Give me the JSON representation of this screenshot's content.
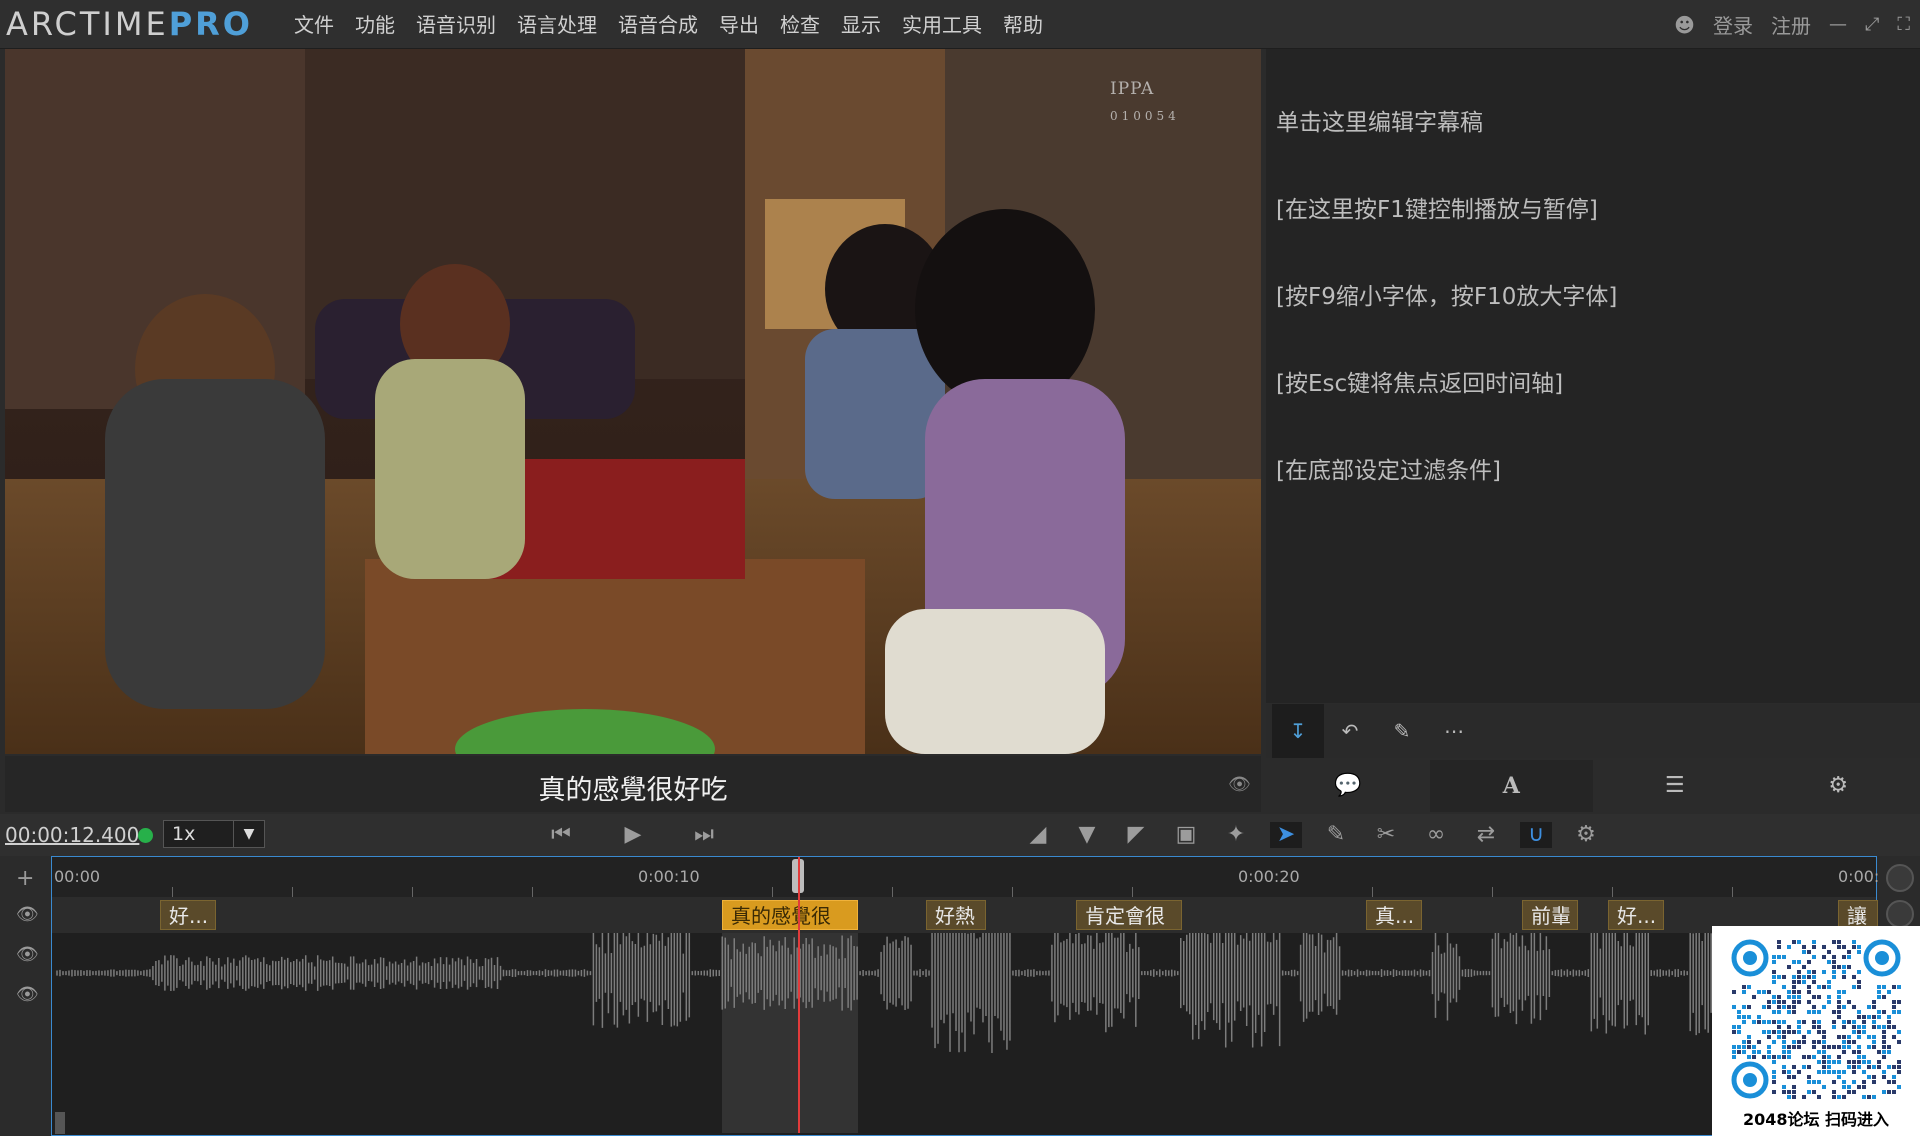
{
  "app": {
    "logo_main": "ARCTIME",
    "logo_pro": "PRO",
    "menus": [
      "文件",
      "功能",
      "语音识别",
      "语言处理",
      "语音合成",
      "导出",
      "检查",
      "显示",
      "实用工具",
      "帮助"
    ],
    "login": "登录",
    "register": "注册"
  },
  "video": {
    "watermark_brand": "IPPA",
    "watermark_code": "010054",
    "current_subtitle": "真的感覺很好吃"
  },
  "editor": {
    "lines": [
      "单击这里编辑字幕稿",
      "[在这里按F1键控制播放与暂停]",
      "[按F9缩小字体，按F10放大字体]",
      "[按Esc键将焦点返回时间轴]",
      "[在底部设定过滤条件]"
    ]
  },
  "transport": {
    "timecode": "00:00:12.400",
    "speed": "1x"
  },
  "timeline": {
    "ruler_labels": [
      "00:00",
      "0:00:10",
      "0:00:20",
      "0:00:"
    ],
    "segments": [
      {
        "text": "好..."
      },
      {
        "text": "真的感覺很",
        "active": true
      },
      {
        "text": "好熱"
      },
      {
        "text": "肯定會很"
      },
      {
        "text": "真..."
      },
      {
        "text": "前輩"
      },
      {
        "text": "好..."
      },
      {
        "text": "讓"
      }
    ]
  },
  "qr": {
    "caption": "2048论坛 扫码进入"
  },
  "colors": {
    "accent": "#4f9fd8",
    "segment_active": "#d99b1f",
    "playhead": "#e23b3b",
    "status_ok": "#27b04a"
  }
}
